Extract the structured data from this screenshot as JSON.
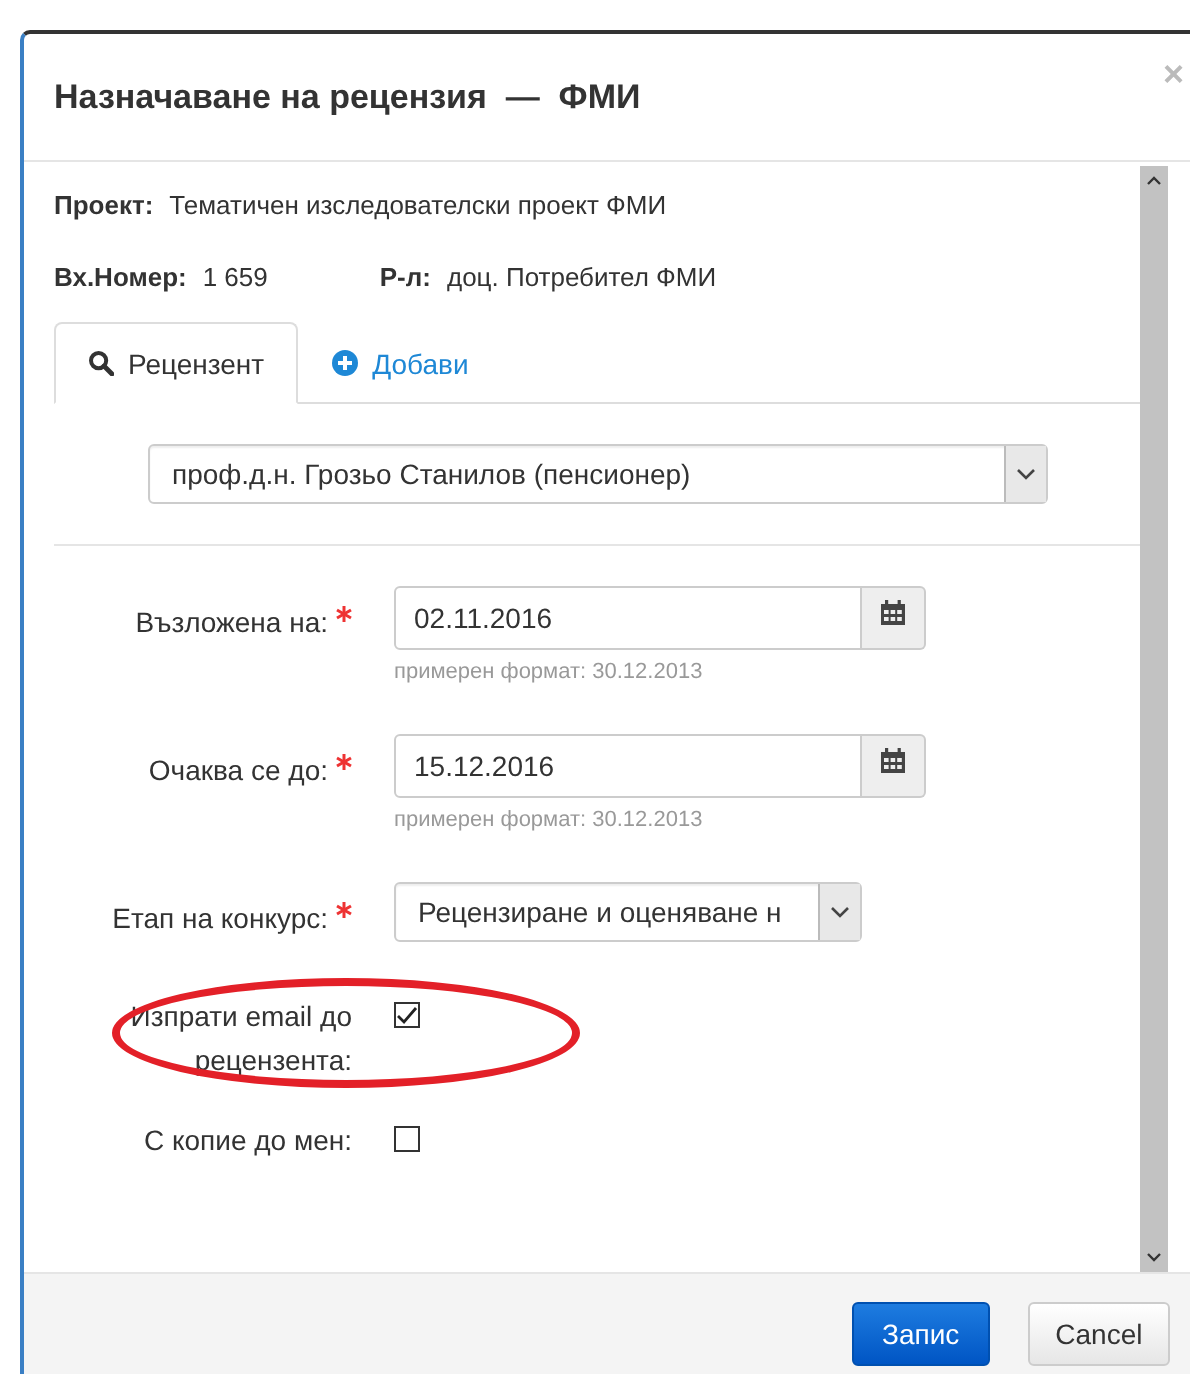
{
  "dialog": {
    "title": "Назначаване на рецензия  —  ФМИ",
    "close": "×"
  },
  "info": [
    {
      "label": "Проект:",
      "value": "Тематичен изследователски проект ФМИ"
    },
    {
      "label": "Вх.Номер:",
      "value": "1 659"
    },
    {
      "label": "Р-л:",
      "value": "доц. Потребител ФМИ"
    }
  ],
  "tabs": [
    {
      "label": "Рецензент",
      "selected": true
    },
    {
      "label": "Добави",
      "selected": false
    }
  ],
  "reviewer_select": {
    "value": "проф.д.н. Грозьо Станилов (пенсионер)"
  },
  "fields": [
    {
      "kind": "date",
      "label": "Възложена на:",
      "required": true,
      "value": "02.11.2016",
      "hint": "примерен формат: 30.12.2013"
    },
    {
      "kind": "date",
      "label": "Очаква се до:",
      "required": true,
      "value": "15.12.2016",
      "hint": "примерен формат: 30.12.2013"
    },
    {
      "kind": "select",
      "label": "Етап на конкурс:",
      "required": true,
      "value": "Рецензиране и оценяване н"
    },
    {
      "kind": "checkbox",
      "label": "Изпрати email до рецензента:",
      "checked": true,
      "highlighted": true
    },
    {
      "kind": "checkbox",
      "label": "С копие до мен:",
      "checked": false,
      "highlighted": false
    }
  ],
  "buttons": [
    {
      "kind": "primary",
      "label": "Запис"
    },
    {
      "kind": "default",
      "label": "Cancel"
    }
  ]
}
